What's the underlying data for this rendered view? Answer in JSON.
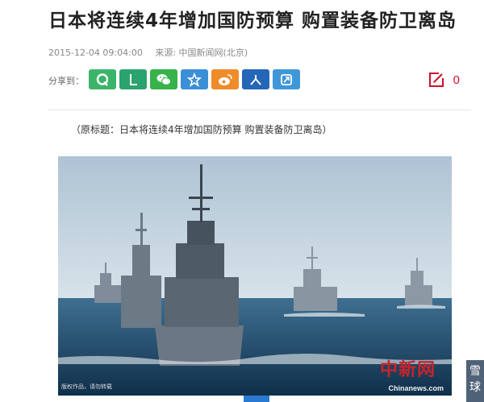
{
  "article": {
    "title": "日本将连续4年增加国防预算  购置装备防卫离岛",
    "datetime": "2015-12-04 09:04:00",
    "source": "来源: 中国新闻网(北京)",
    "caption": "（原标题：日本将连续4年增加国防预算 购置装备防卫离岛）"
  },
  "share": {
    "label": "分享到：",
    "buttons": [
      {
        "name": "qzone",
        "color": "#3bb46a"
      },
      {
        "name": "pengyou",
        "color": "#2aa36e"
      },
      {
        "name": "wechat",
        "color": "#36b34a"
      },
      {
        "name": "favorites",
        "color": "#3b8fd6"
      },
      {
        "name": "weibo",
        "color": "#f08b2a"
      },
      {
        "name": "renren",
        "color": "#2467b8"
      },
      {
        "name": "other",
        "color": "#3f97d8"
      }
    ],
    "comment_count": "0",
    "comment_icon_color": "#d0112b"
  },
  "photo": {
    "credit": "版权作品，请勿转载",
    "watermark_cn": "中新网",
    "watermark_en": "Chinanews.com"
  },
  "side_logo": {
    "line1": "雪",
    "line2": "球"
  }
}
